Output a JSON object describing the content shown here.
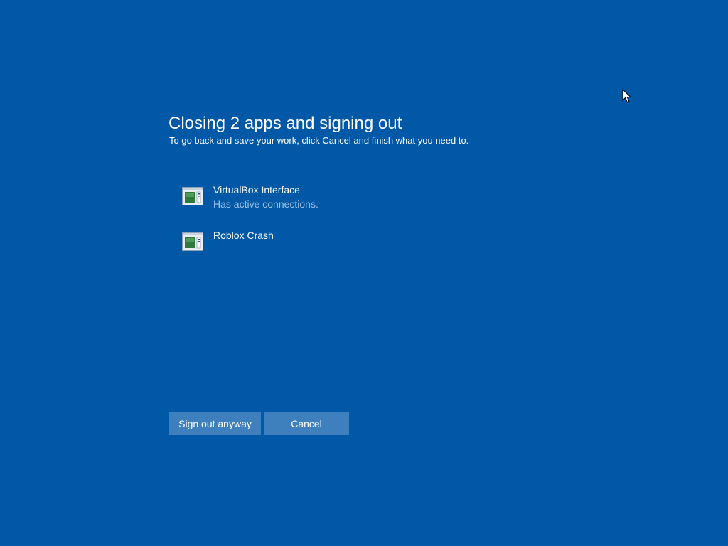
{
  "dialog": {
    "title": "Closing 2 apps and signing out",
    "subtitle": "To go back and save your work, click Cancel and finish what you need to."
  },
  "apps": [
    {
      "name": "VirtualBox Interface",
      "status": "Has active connections.",
      "icon": "app-window-icon"
    },
    {
      "name": "Roblox Crash",
      "status": "",
      "icon": "app-window-icon"
    }
  ],
  "buttons": {
    "sign_out_label": "Sign out anyway",
    "cancel_label": "Cancel"
  },
  "colors": {
    "background": "#0058a6",
    "button": "#3e7fbe",
    "status_text": "#9ec3ea"
  }
}
